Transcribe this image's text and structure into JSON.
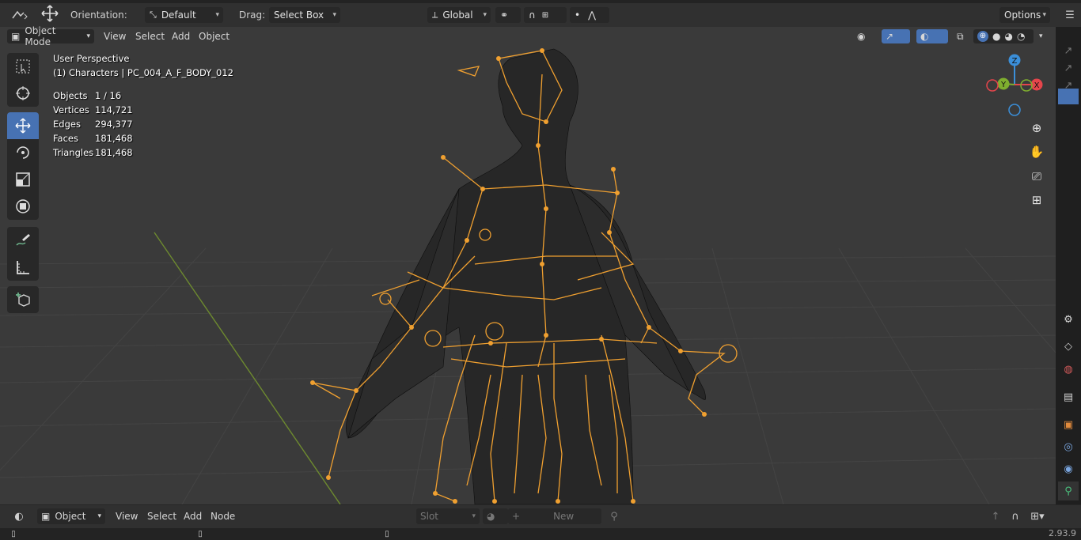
{
  "top_header": {
    "orientation_label": "Orientation:",
    "orientation_value": "Default",
    "drag_label": "Drag:",
    "drag_value": "Select Box",
    "transform_space": "Global",
    "options_label": "Options"
  },
  "viewport_header": {
    "mode": "Object Mode",
    "menus": [
      "View",
      "Select",
      "Add",
      "Object"
    ]
  },
  "overlay_info": {
    "view_name": "User Perspective",
    "active_object": "(1) Characters | PC_004_A_F_BODY_012",
    "stats": [
      {
        "label": "Objects",
        "value": "1 / 16"
      },
      {
        "label": "Vertices",
        "value": "114,721"
      },
      {
        "label": "Edges",
        "value": "294,377"
      },
      {
        "label": "Faces",
        "value": "181,468"
      },
      {
        "label": "Triangles",
        "value": "181,468"
      }
    ]
  },
  "gizmo": {
    "axes": [
      "Z",
      "Y",
      "X"
    ],
    "colors": {
      "x": "#e5454b",
      "y": "#7fae2f",
      "z": "#3b8fd9"
    }
  },
  "toolbar_tools": [
    "select-box",
    "cursor",
    "move",
    "rotate",
    "scale",
    "transform",
    "annotate",
    "measure",
    "add-cube"
  ],
  "bottom_editor": {
    "type": "Object",
    "menus": [
      "View",
      "Select",
      "Add",
      "Node"
    ],
    "slot_label": "Slot",
    "new_label": "New"
  },
  "status": {
    "version": "2.93.9"
  },
  "colors": {
    "accent": "#4772b3",
    "armature": "#f0a030",
    "mesh_wire": "#101010",
    "grid": "#4a4a4a"
  }
}
